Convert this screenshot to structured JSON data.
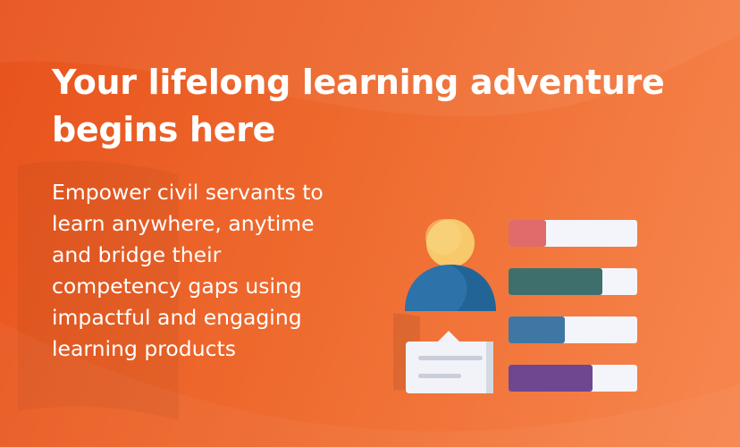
{
  "hero": {
    "headline": "Your lifelong learning adventure begins here",
    "description": "Empower civil servants to learn anywhere, anytime and bridge their competency gaps using impactful and engaging learning products"
  },
  "colors": {
    "background_start": "#e8521c",
    "background_end": "#f7874f",
    "text": "#ffffff",
    "person_head": "#f7c96a",
    "person_body": "#2d72a8",
    "card": "#f1f3f8"
  },
  "progress_bars": [
    {
      "fill": 0.29,
      "color": "#e06b6b"
    },
    {
      "fill": 0.73,
      "color": "#3f6f6c"
    },
    {
      "fill": 0.44,
      "color": "#3e77a3"
    },
    {
      "fill": 0.65,
      "color": "#6e4791"
    }
  ],
  "icons": {
    "person": "learner-avatar-icon",
    "chat": "chat-card-icon",
    "book": "open-book-icon"
  }
}
